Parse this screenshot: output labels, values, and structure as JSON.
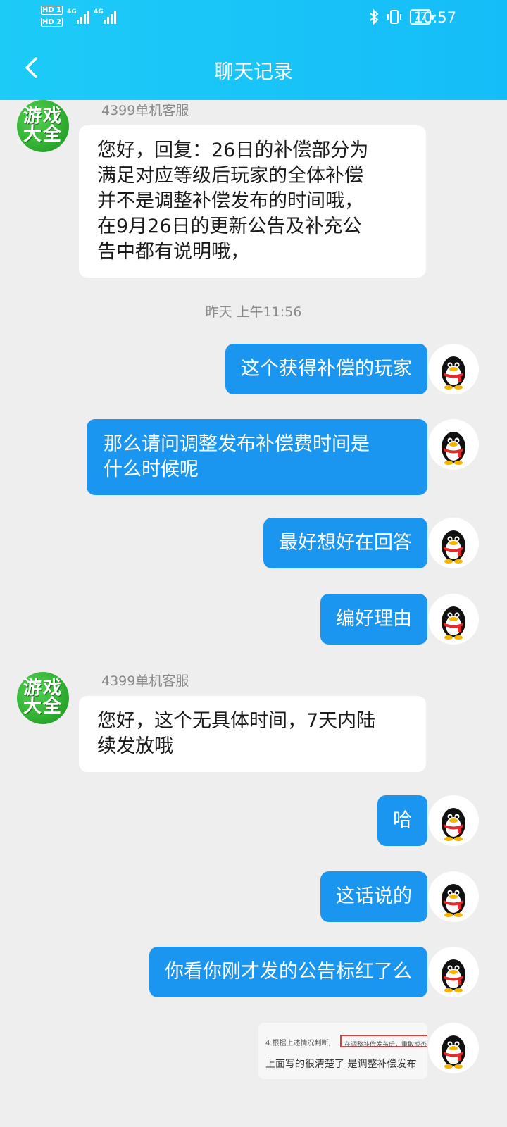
{
  "status_bar": {
    "hd1": "HD 1",
    "hd2": "HD 2",
    "sig1_label": "4G",
    "sig2_label": "4G",
    "battery": "77",
    "time": "10:57"
  },
  "navbar": {
    "title": "聊天记录",
    "back_icon": "chevron-left-icon"
  },
  "colors": {
    "header": "#1dcbf7",
    "outgoing_bubble": "#1a96f0",
    "background": "#eeeeee"
  },
  "messages": [
    {
      "from": "service",
      "sender": "4399单机客服",
      "avatar_text": [
        "游戏",
        "大全"
      ],
      "lines": [
        "您好，回复：26日的补偿部分为",
        "满足对应等级后玩家的全体补偿",
        "并不是调整补偿发布的时间哦，",
        "在9月26日的更新公告及补充公",
        "告中都有说明哦，"
      ]
    },
    {
      "from": "timestamp",
      "text": "昨天 上午11:56"
    },
    {
      "from": "me",
      "text": "这个获得补偿的玩家"
    },
    {
      "from": "me",
      "lines": [
        "那么请问调整发布补偿费时间是",
        "什么时候呢"
      ]
    },
    {
      "from": "me",
      "text": "最好想好在回答"
    },
    {
      "from": "me",
      "text": "编好理由"
    },
    {
      "from": "service",
      "sender": "4399单机客服",
      "avatar_text": [
        "游戏",
        "大全"
      ],
      "lines": [
        "您好，这个无具体时间，7天内陆",
        "续发放哦"
      ]
    },
    {
      "from": "me",
      "text": "哈"
    },
    {
      "from": "me",
      "text": "这话说的"
    },
    {
      "from": "me",
      "text": "你看你刚才发的公告标红了么"
    },
    {
      "from": "me_image",
      "image_line1": "4.根据上述情况判断,",
      "image_boxed": "在调整补偿发布后，重取或否例",
      "image_caption": "上面写的很清楚了 是调整补偿发布"
    }
  ]
}
